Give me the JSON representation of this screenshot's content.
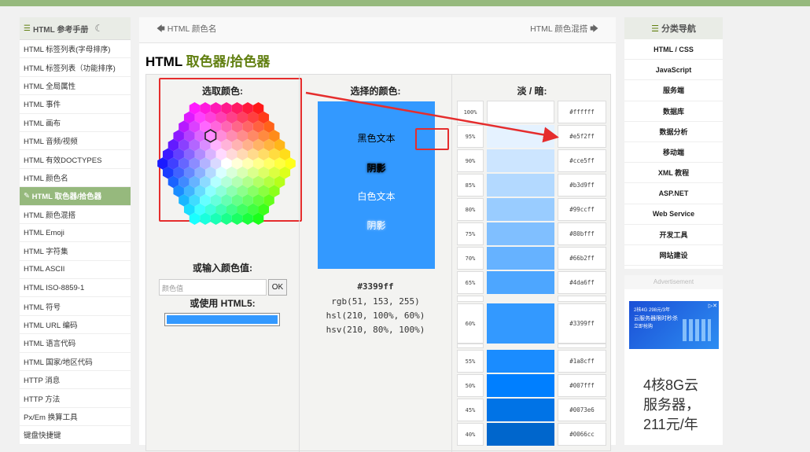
{
  "sidebar": {
    "title": "HTML 参考手册",
    "items": [
      "HTML 标签列表(字母排序)",
      "HTML 标签列表（功能排序)",
      "HTML 全局属性",
      "HTML 事件",
      "HTML 画布",
      "HTML 音频/视频",
      "HTML 有效DOCTYPES",
      "HTML 颜色名",
      "HTML 取色器/拾色器",
      "HTML 颜色混搭",
      "HTML Emoji",
      "HTML 字符集",
      "HTML ASCII",
      "HTML ISO-8859-1",
      "HTML 符号",
      "HTML URL 编码",
      "HTML 语言代码",
      "HTML 国家/地区代码",
      "HTTP 消息",
      "HTTP 方法",
      "Px/Em 换算工具",
      "键盘快捷键"
    ],
    "active_index": 8
  },
  "nav": {
    "prev": "HTML 颜色名",
    "next": "HTML 颜色混搭"
  },
  "page": {
    "title_prefix": "HTML ",
    "title_highlight": "取色器/拾色器"
  },
  "picker": {
    "heading_select": "选取颜色:",
    "heading_input": "或输入颜色值:",
    "input_placeholder": "颜色值",
    "ok_label": "OK",
    "heading_html5": "或使用 HTML5:"
  },
  "selected": {
    "heading": "选择的颜色:",
    "black_text": "黑色文本",
    "shadow1": "阴影",
    "white_text": "白色文本",
    "shadow2": "阴影",
    "hex": "#3399ff",
    "rgb": "rgb(51, 153, 255)",
    "hsl": "hsl(210, 100%, 60%)",
    "hsv": "hsv(210, 80%, 100%)",
    "color": "#3399ff"
  },
  "shades": {
    "heading": "淡 / 暗:",
    "rows": [
      {
        "pct": "100%",
        "hex": "#ffffff"
      },
      {
        "pct": "95%",
        "hex": "#e5f2ff"
      },
      {
        "pct": "90%",
        "hex": "#cce5ff"
      },
      {
        "pct": "85%",
        "hex": "#b3d9ff"
      },
      {
        "pct": "80%",
        "hex": "#99ccff"
      },
      {
        "pct": "75%",
        "hex": "#80bfff"
      },
      {
        "pct": "70%",
        "hex": "#66b2ff"
      },
      {
        "pct": "65%",
        "hex": "#4da6ff"
      },
      {
        "pct": "60%",
        "hex": "#3399ff"
      },
      {
        "pct": "55%",
        "hex": "#1a8cff"
      },
      {
        "pct": "50%",
        "hex": "#007fff"
      },
      {
        "pct": "45%",
        "hex": "#0073e6"
      },
      {
        "pct": "40%",
        "hex": "#0066cc"
      }
    ]
  },
  "right_sidebar": {
    "title": "分类导航",
    "items": [
      "HTML / CSS",
      "JavaScript",
      "服务端",
      "数据库",
      "数据分析",
      "移动端",
      "XML 教程",
      "ASP.NET",
      "Web Service",
      "开发工具",
      "网站建设"
    ]
  },
  "ad": {
    "label": "Advertisement",
    "line1": "2核4G 298元/3年",
    "line2": "云服务器限时秒杀",
    "line3": "立即抢购",
    "text1": "4核8G云",
    "text2": "服务器，",
    "text3": "211元/年"
  },
  "colors": {
    "accent": "#617f10",
    "sidebar_active": "#96b97d",
    "highlight_red": "#e52d2d"
  }
}
